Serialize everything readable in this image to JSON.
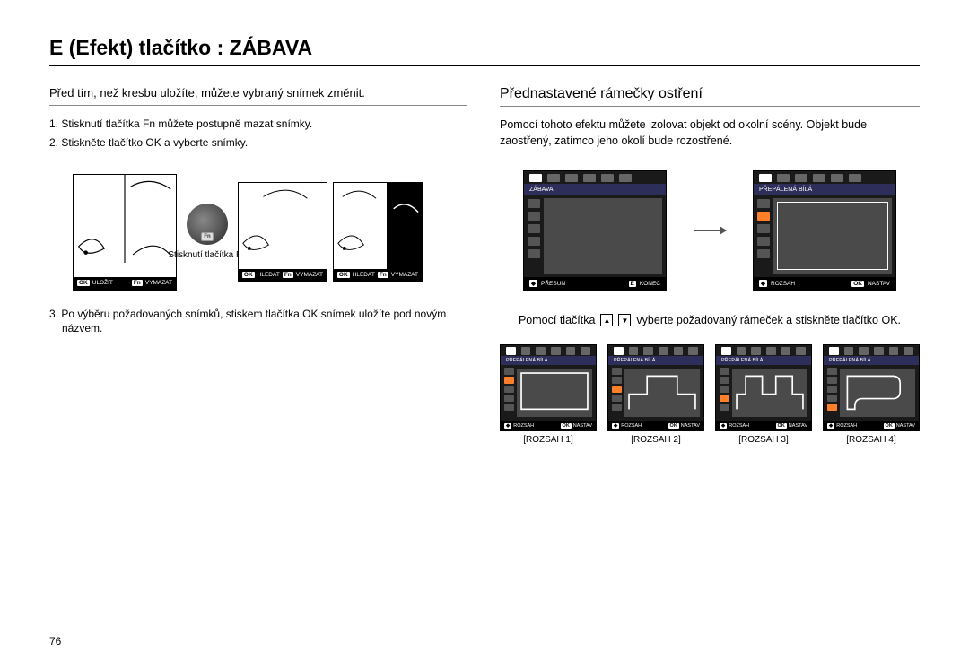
{
  "page": {
    "title": "E (Efekt) tlačítko : ZÁBAVA",
    "number": "76"
  },
  "left": {
    "intro": "Před tím, než kresbu uložíte, můžete vybraný snímek změnit.",
    "step1": "1. Stisknutí tlačítka Fn můžete postupně mazat snímky.",
    "step2": "2. Stiskněte tlačítko OK a vyberte snímky.",
    "fnCaption": "Stisknutí tlačítka Fn",
    "fnKey": "Fn",
    "bar1": {
      "ok": "OK",
      "okLabel": "ULOŽIT",
      "fn": "Fn",
      "fnLabel": "VYMAZAT"
    },
    "bar2": {
      "ok": "OK",
      "okLabel": "HLEDAT",
      "fn": "Fn",
      "fnLabel": "VYMAZAT"
    },
    "step3": "3. Po výběru požadovaných snímků, stiskem tlačítka OK snímek uložíte pod novým názvem."
  },
  "right": {
    "subtitle": "Přednastavené rámečky ostření",
    "desc": "Pomocí tohoto efektu můžete izolovat objekt od okolní scény. Objekt bude zaostřený, zatímco jeho okolí bude rozostřené.",
    "lcd1": {
      "mode": "ZÁBAVA",
      "f1k": "◆",
      "f1l": "PŘESUN",
      "f2k": "E",
      "f2l": "KONEC"
    },
    "lcd2": {
      "mode": "PŘEPÁLENÁ BÍLÁ",
      "f1k": "◆",
      "f1l": "ROZSAH",
      "f2k": "OK",
      "f2l": "NASTAV"
    },
    "hintPre": "Pomocí tlačítka",
    "hintPost": "vyberte požadovaný rámeček a stiskněte tlačítko OK.",
    "thumbs": {
      "mode": "PŘEPÁLENÁ BÍLÁ",
      "footer": {
        "k1": "◆",
        "l1": "ROZSAH",
        "k2": "OK",
        "l2": "NASTAV"
      },
      "labels": [
        "[ROZSAH 1]",
        "[ROZSAH 2]",
        "[ROZSAH 3]",
        "[ROZSAH 4]"
      ]
    }
  }
}
